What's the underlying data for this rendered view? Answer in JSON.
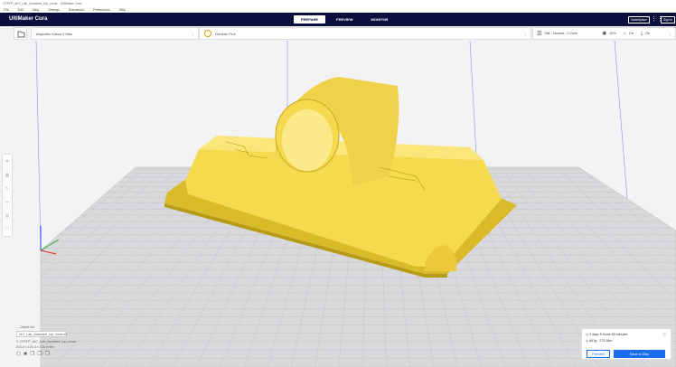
{
  "window": {
    "title": "CFFFP_Ab7_Lab_Assistant_top_cover - UltiMaker Cura"
  },
  "menu": [
    "File",
    "Edit",
    "View",
    "Settings",
    "Extensions",
    "Preferences",
    "Help"
  ],
  "header": {
    "logo": "UltiMaker Cura",
    "stages": [
      "PREPARE",
      "PREVIEW",
      "MONITOR"
    ],
    "marketplace": "Marketplace",
    "signin": "Sign In"
  },
  "toolbar": {
    "printer": "Anycubic Kobra 2 Max",
    "material": "Generic PLA",
    "profile": "Silk - Normal - 0.2mm",
    "infill": "10%",
    "support": "On",
    "adhesion": "On"
  },
  "objects": {
    "header": "Object list",
    "filename": "Ab7_Lab_Assistant_top_cover.stl",
    "name": "CFFFP_Ab7_Lab_Assistant_top_cover",
    "dims": "201.8 x 100.3 x 124.9 mm"
  },
  "print": {
    "time": "3 days 5 hours 50 minutes",
    "material": "661g · 273.38m",
    "preview": "Preview",
    "save": "Save to Disk"
  },
  "colors": {
    "header": "#0a0f3d",
    "accent": "#196ef0",
    "model": "#f5d94e"
  }
}
